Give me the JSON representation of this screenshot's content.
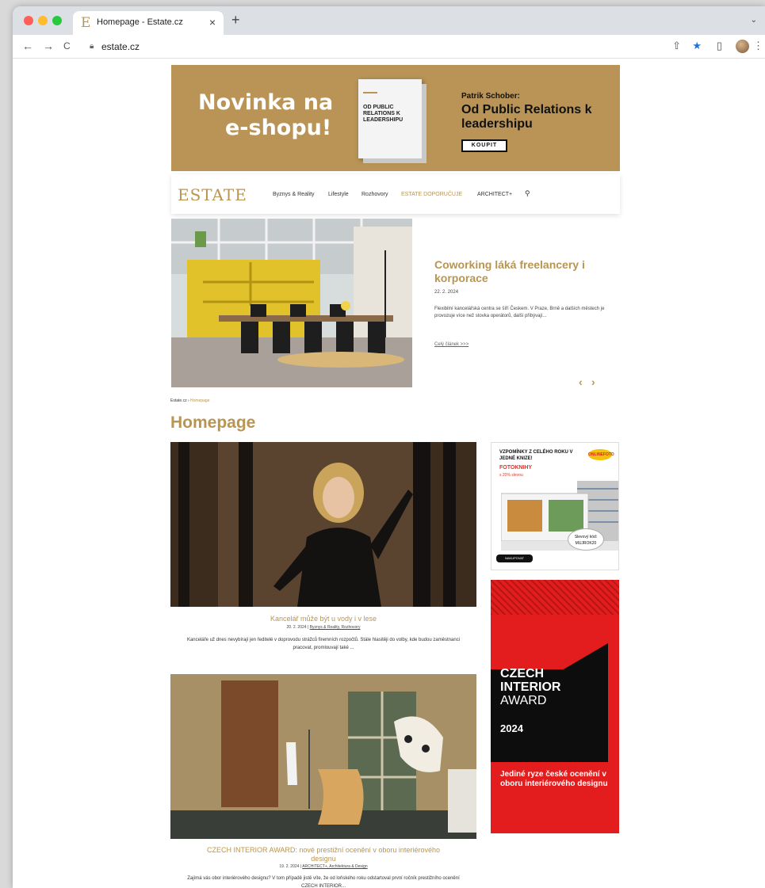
{
  "browser": {
    "tab_title": "Homepage - Estate.cz",
    "favicon_letter": "E",
    "close": "×",
    "new_tab": "+",
    "tab_chevron": "⌄",
    "back": "←",
    "forward": "→",
    "reload": "C",
    "url": "estate.cz",
    "share": "⇧",
    "bookmark": "★",
    "sidepanel": "▯",
    "menu": "⋮"
  },
  "banner": {
    "headline_line1": "Novinka na",
    "headline_line2": "e-shopu!",
    "book_cover_text": "OD PUBLIC RELATIONS K LEADERSHIPU",
    "author": "Patrik Schober:",
    "book_title": "Od Public Relations k leadershipu",
    "button": "KOUPIT"
  },
  "nav": {
    "logo": "ESTATE",
    "items": [
      {
        "label": "Byznys & Reality"
      },
      {
        "label": "Lifestyle"
      },
      {
        "label": "Rozhovory"
      },
      {
        "label": "ESTATE DOPORUČUJE"
      },
      {
        "label": "ARCHITECT+"
      }
    ],
    "search_icon": "⚲"
  },
  "hero": {
    "title": "Coworking láká freelancery i korporace",
    "date": "22. 2. 2024",
    "excerpt": "Flexibilní kancelářská centra se šíří Českem. V Praze, Brně a dalších městech je provozuje více než stovka operátorů, další přibývají...",
    "more": "Celý článek >>>",
    "prev": "‹",
    "next": "›"
  },
  "breadcrumb": {
    "home": "Estate.cz",
    "sep": " › ",
    "current": "Homepage"
  },
  "page_title": "Homepage",
  "articles": [
    {
      "title": "Kancelář může být u vody i v lese",
      "date": "20. 2. 2024 | ",
      "categories": "Byznys & Reality, Rozhovory",
      "excerpt": "Kanceláře už dnes nevybírají jen ředitelé v doprovodu strážců firemních rozpočtů. Stále hlasitěji do volby, kde budou zaměstnanci pracovat, promlouvají také ..."
    },
    {
      "title": "CZECH INTERIOR AWARD: nové prestižní ocenění v oboru interiérového designu",
      "date": "19. 2. 2024 | ",
      "categories": "ARCHITECT+, Architektura & Design",
      "excerpt": "Zajímá vás obor interiérového designu? V tom případě jistě víte, že od loňského roku odstartoval první ročník prestižního ocenění CZECH INTERIOR..."
    }
  ],
  "ad_photobook": {
    "headline": "VZPOMÍNKY Z CELÉHO ROKU V JEDNÉ KNIZE!",
    "product": "FOTOKNIHY",
    "discount": "s 20% slevou",
    "brand": "ONLINEFOTO",
    "code_label": "Slevový kód:",
    "code": "MUJROK20",
    "button": "NAKUPOVAT"
  },
  "ad_award": {
    "line1": "CZECH",
    "line2": "INTERIOR",
    "line3": "AWARD",
    "year": "2024",
    "tagline": "Jediné ryze české ocenění v oboru interiérového designu"
  },
  "colors": {
    "accent": "#b89550",
    "award_red": "#e31d1d"
  }
}
